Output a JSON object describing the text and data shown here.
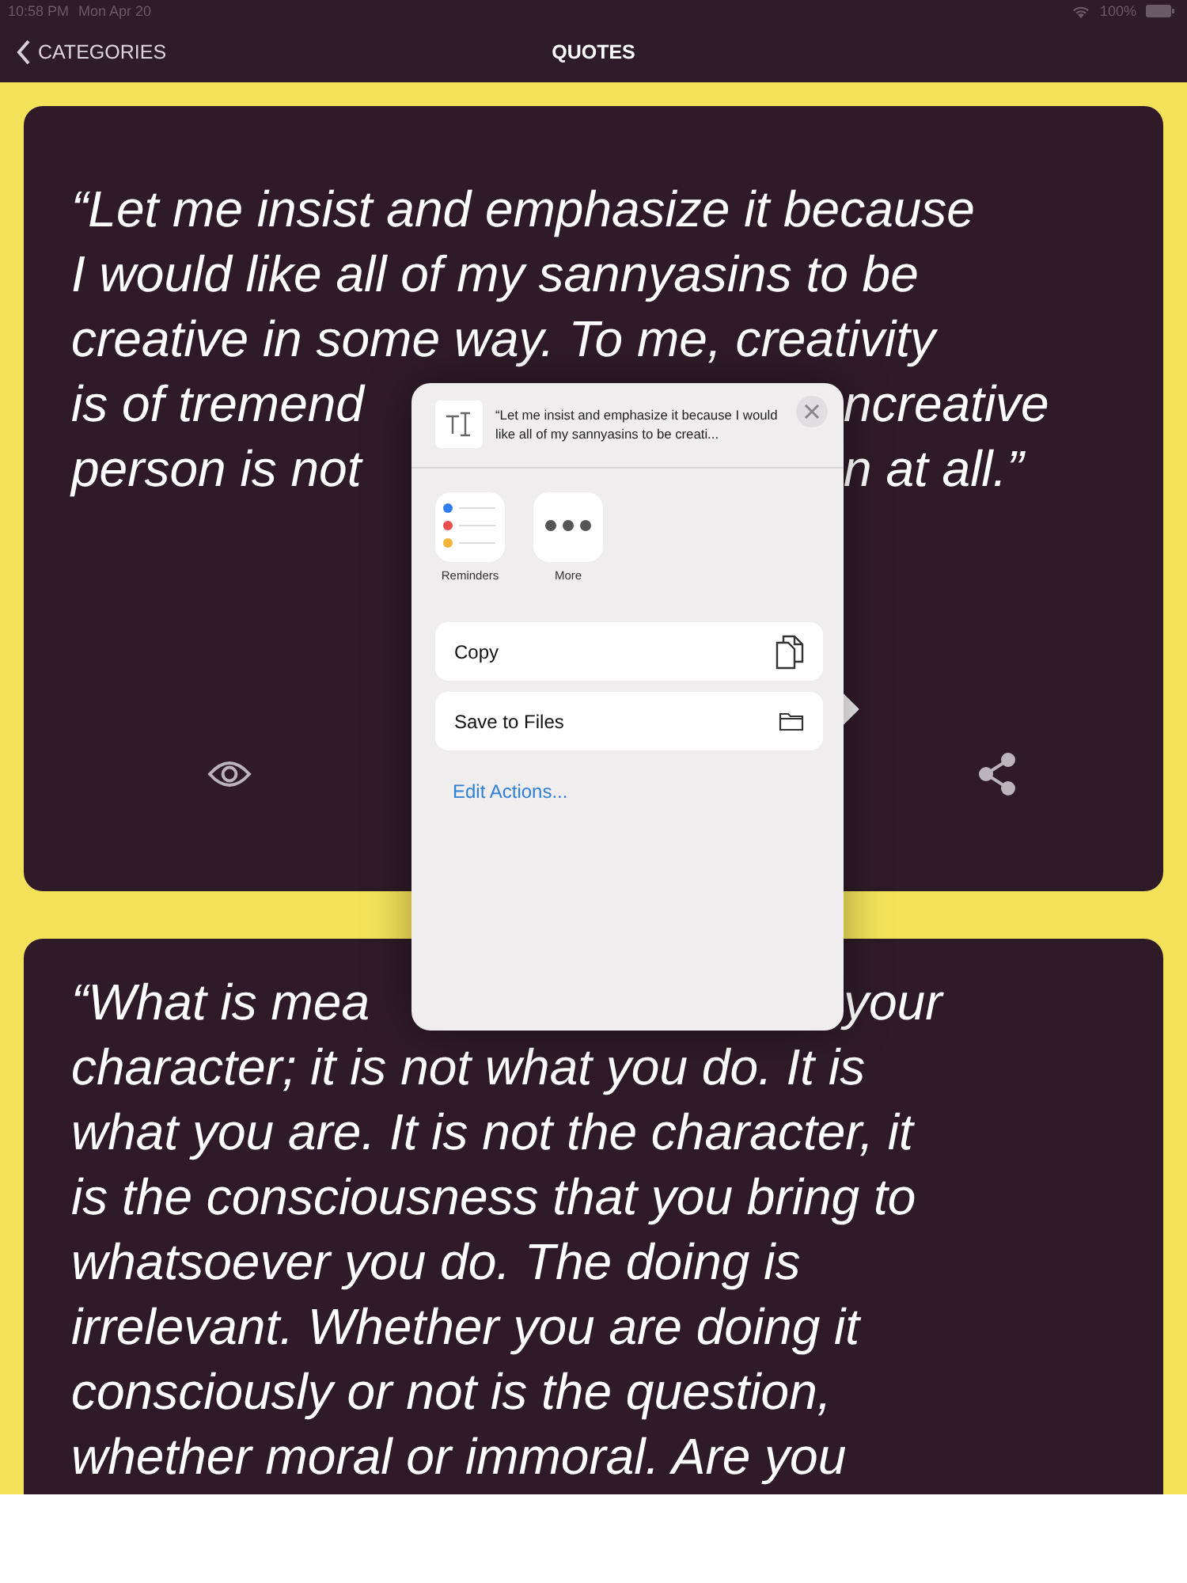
{
  "status_bar": {
    "time": "10:58 PM",
    "date": "Mon Apr 20",
    "battery": "100%"
  },
  "nav": {
    "back_label": "CATEGORIES",
    "title": "QUOTES"
  },
  "quotes": [
    {
      "lines": [
        [
          "“Let me insist and emphasize it because"
        ],
        [
          "I would like all of my sannyasins to be"
        ],
        [
          "creative in some way. To me, creativity"
        ],
        [
          "is of tremend",
          "ncreative"
        ],
        [
          "person is not",
          "n at all.”"
        ]
      ],
      "actions": [
        {
          "kind": "view"
        },
        {
          "kind": "share"
        }
      ]
    },
    {
      "lines": [
        [
          "“What is mea",
          "your"
        ],
        [
          "character; it is not what you do. It is"
        ],
        [
          "what you are. It is not the character, it"
        ],
        [
          "is the consciousness that you bring to"
        ],
        [
          "whatsoever you do. The doing is"
        ],
        [
          "irrelevant. Whether you are doing it"
        ],
        [
          "consciously or not is the question,"
        ],
        [
          "whether moral or immoral. Are you"
        ]
      ]
    }
  ],
  "share_sheet": {
    "preview": "“Let me insist and emphasize it because I would like all of my sannyasins to be creati...",
    "apps": [
      {
        "kind": "reminders",
        "label": "Reminders"
      },
      {
        "kind": "more",
        "label": "More"
      }
    ],
    "actions": [
      {
        "kind": "copy",
        "label": "Copy"
      },
      {
        "kind": "files",
        "label": "Save to Files"
      }
    ],
    "edit_link": "Edit Actions..."
  }
}
